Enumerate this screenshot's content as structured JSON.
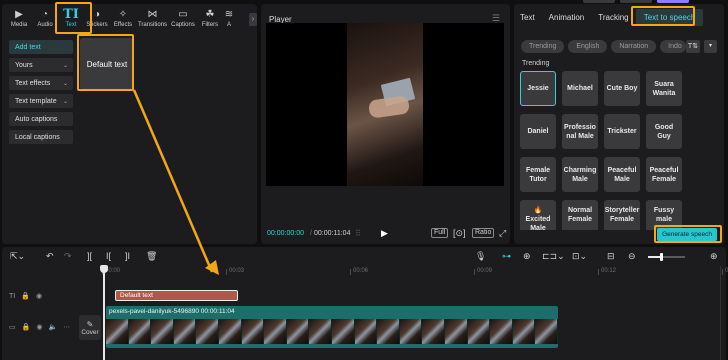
{
  "left_panel": {
    "tabs": [
      {
        "label": "Media",
        "icon": "media-icon",
        "active": false
      },
      {
        "label": "Audio",
        "icon": "audio-icon",
        "active": false
      },
      {
        "label": "Text",
        "icon": "text-icon",
        "active": true
      },
      {
        "label": "Stickers",
        "icon": "stickers-icon",
        "active": false
      },
      {
        "label": "Effects",
        "icon": "effects-icon",
        "active": false
      },
      {
        "label": "Transitions",
        "icon": "transitions-icon",
        "active": false
      },
      {
        "label": "Captions",
        "icon": "captions-icon",
        "active": false
      },
      {
        "label": "Filters",
        "icon": "filters-icon",
        "active": false
      },
      {
        "label": "A",
        "icon": "adjust-icon",
        "active": false
      }
    ],
    "more_glyph": "›",
    "side_menu": [
      {
        "label": "Add text",
        "active": true,
        "has_dropdown": false
      },
      {
        "label": "Yours",
        "active": false,
        "has_dropdown": true
      },
      {
        "label": "Text effects",
        "active": false,
        "has_dropdown": true
      },
      {
        "label": "Text template",
        "active": false,
        "has_dropdown": true
      },
      {
        "label": "Auto captions",
        "active": false,
        "has_dropdown": false
      },
      {
        "label": "Local captions",
        "active": false,
        "has_dropdown": false
      }
    ],
    "default_text_card": "Default text"
  },
  "player": {
    "title": "Player",
    "current_time": "00:00:00:00",
    "separator": "/",
    "total_time": "00:00:11:04",
    "ratio_label": "Ratio",
    "full_label": "Full"
  },
  "right_panel": {
    "tabs": [
      "Text",
      "Animation",
      "Tracking"
    ],
    "active_tab": "Text to speech",
    "filters": [
      "Trending",
      "English",
      "Narration",
      "Indo"
    ],
    "section_title": "Trending",
    "voices": [
      {
        "name": "Jessie",
        "selected": true
      },
      {
        "name": "Michael",
        "selected": false
      },
      {
        "name": "Cute Boy",
        "selected": false
      },
      {
        "name": "Suara Wanita",
        "selected": false
      },
      {
        "name": "Daniel",
        "selected": false
      },
      {
        "name": "Professio nal Male",
        "selected": false
      },
      {
        "name": "Trickster",
        "selected": false
      },
      {
        "name": "Good Guy",
        "selected": false
      },
      {
        "name": "Female Tutor",
        "selected": false
      },
      {
        "name": "Charming Male",
        "selected": false
      },
      {
        "name": "Peaceful Male",
        "selected": false
      },
      {
        "name": "Peaceful Female",
        "selected": false
      },
      {
        "name": "🔥Excited Male",
        "selected": false
      },
      {
        "name": "Normal Female",
        "selected": false
      },
      {
        "name": "Storyteller Female",
        "selected": false
      },
      {
        "name": "Fussy male",
        "selected": false
      }
    ],
    "generate_label": "Generate speech"
  },
  "timeline": {
    "ruler": [
      {
        "label": "00:00",
        "pos": 0
      },
      {
        "label": "00:03",
        "pos": 1
      },
      {
        "label": "00:06",
        "pos": 2
      },
      {
        "label": "00:09",
        "pos": 3
      },
      {
        "label": "00:12",
        "pos": 4
      },
      {
        "label": "0",
        "pos": 5
      }
    ],
    "text_clip_label": "Default text",
    "video_clip_label": "pexels-pavel-danilyuk-5496890  00:00:11:04",
    "cover_label": "Cover",
    "track_text_icon": "TI",
    "zoom_level": 0.35
  },
  "colors": {
    "accent": "#33d1d9",
    "highlight": "#f3a712",
    "text_clip": "#b0574b",
    "video_clip": "#1b6e6a"
  }
}
